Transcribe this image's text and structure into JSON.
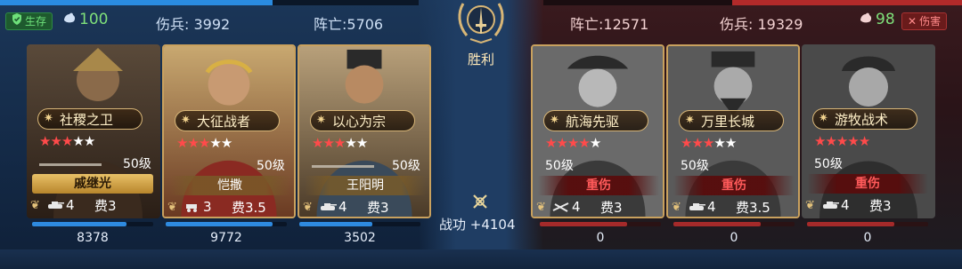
{
  "top": {
    "left": {
      "status": "生存",
      "troops": "100",
      "wounded_label": "伤兵: 3992",
      "dead_label": "阵亡:5706",
      "hp_fraction": 0.65
    },
    "right": {
      "status": "伤害",
      "troops": "98",
      "wounded_label": "伤兵: 19329",
      "dead_label": "阵亡:12571",
      "hp_fraction": 0.55
    }
  },
  "center": {
    "result": "胜利",
    "merit_label": "战功 +4104"
  },
  "left_team": [
    {
      "skill": "社稷之卫",
      "stars": 3,
      "max_stars": 5,
      "level": "50级",
      "name": "戚继光",
      "unit_count": "4",
      "cost": "费3",
      "hp": "8378",
      "hp_fraction": 0.78
    },
    {
      "skill": "大征战者",
      "stars": 3,
      "max_stars": 5,
      "level": "50级",
      "name": "恺撒",
      "unit_count": "3",
      "cost": "费3.5",
      "hp": "9772",
      "hp_fraction": 0.88
    },
    {
      "skill": "以心为宗",
      "stars": 3,
      "max_stars": 5,
      "level": "50级",
      "name": "王阳明",
      "unit_count": "4",
      "cost": "费3",
      "hp": "3502",
      "hp_fraction": 0.6
    }
  ],
  "right_team": [
    {
      "skill": "航海先驱",
      "stars": 4,
      "max_stars": 5,
      "level": "50级",
      "status": "重伤",
      "unit_count": "4",
      "cost": "费3",
      "hp": "0",
      "hp_fraction": 0.72
    },
    {
      "skill": "万里长城",
      "stars": 3,
      "max_stars": 5,
      "level": "50级",
      "status": "重伤",
      "unit_count": "4",
      "cost": "费3.5",
      "hp": "0",
      "hp_fraction": 0.72
    },
    {
      "skill": "游牧战术",
      "stars": 5,
      "max_stars": 5,
      "level": "50级",
      "status": "重伤",
      "unit_count": "4",
      "cost": "费3",
      "hp": "0",
      "hp_fraction": 0.72
    }
  ],
  "icons": {
    "status_left": "shield-check-icon",
    "status_right": "cross-icon",
    "troop": "muscle-arm-icon",
    "emblem": "laurel-sword-emblem-icon",
    "merit": "crossed-swords-icon",
    "skill": "gear-icon",
    "unit_left": [
      "tank-icon",
      "chariot-icon",
      "tank-icon"
    ],
    "unit_right": [
      "musket-icon",
      "tank-icon",
      "tank-icon"
    ]
  },
  "colors": {
    "left_accent": "#2a8be0",
    "right_accent": "#b22a2a",
    "gold": "#c9a15e",
    "star_on": "#ff4a4a"
  }
}
